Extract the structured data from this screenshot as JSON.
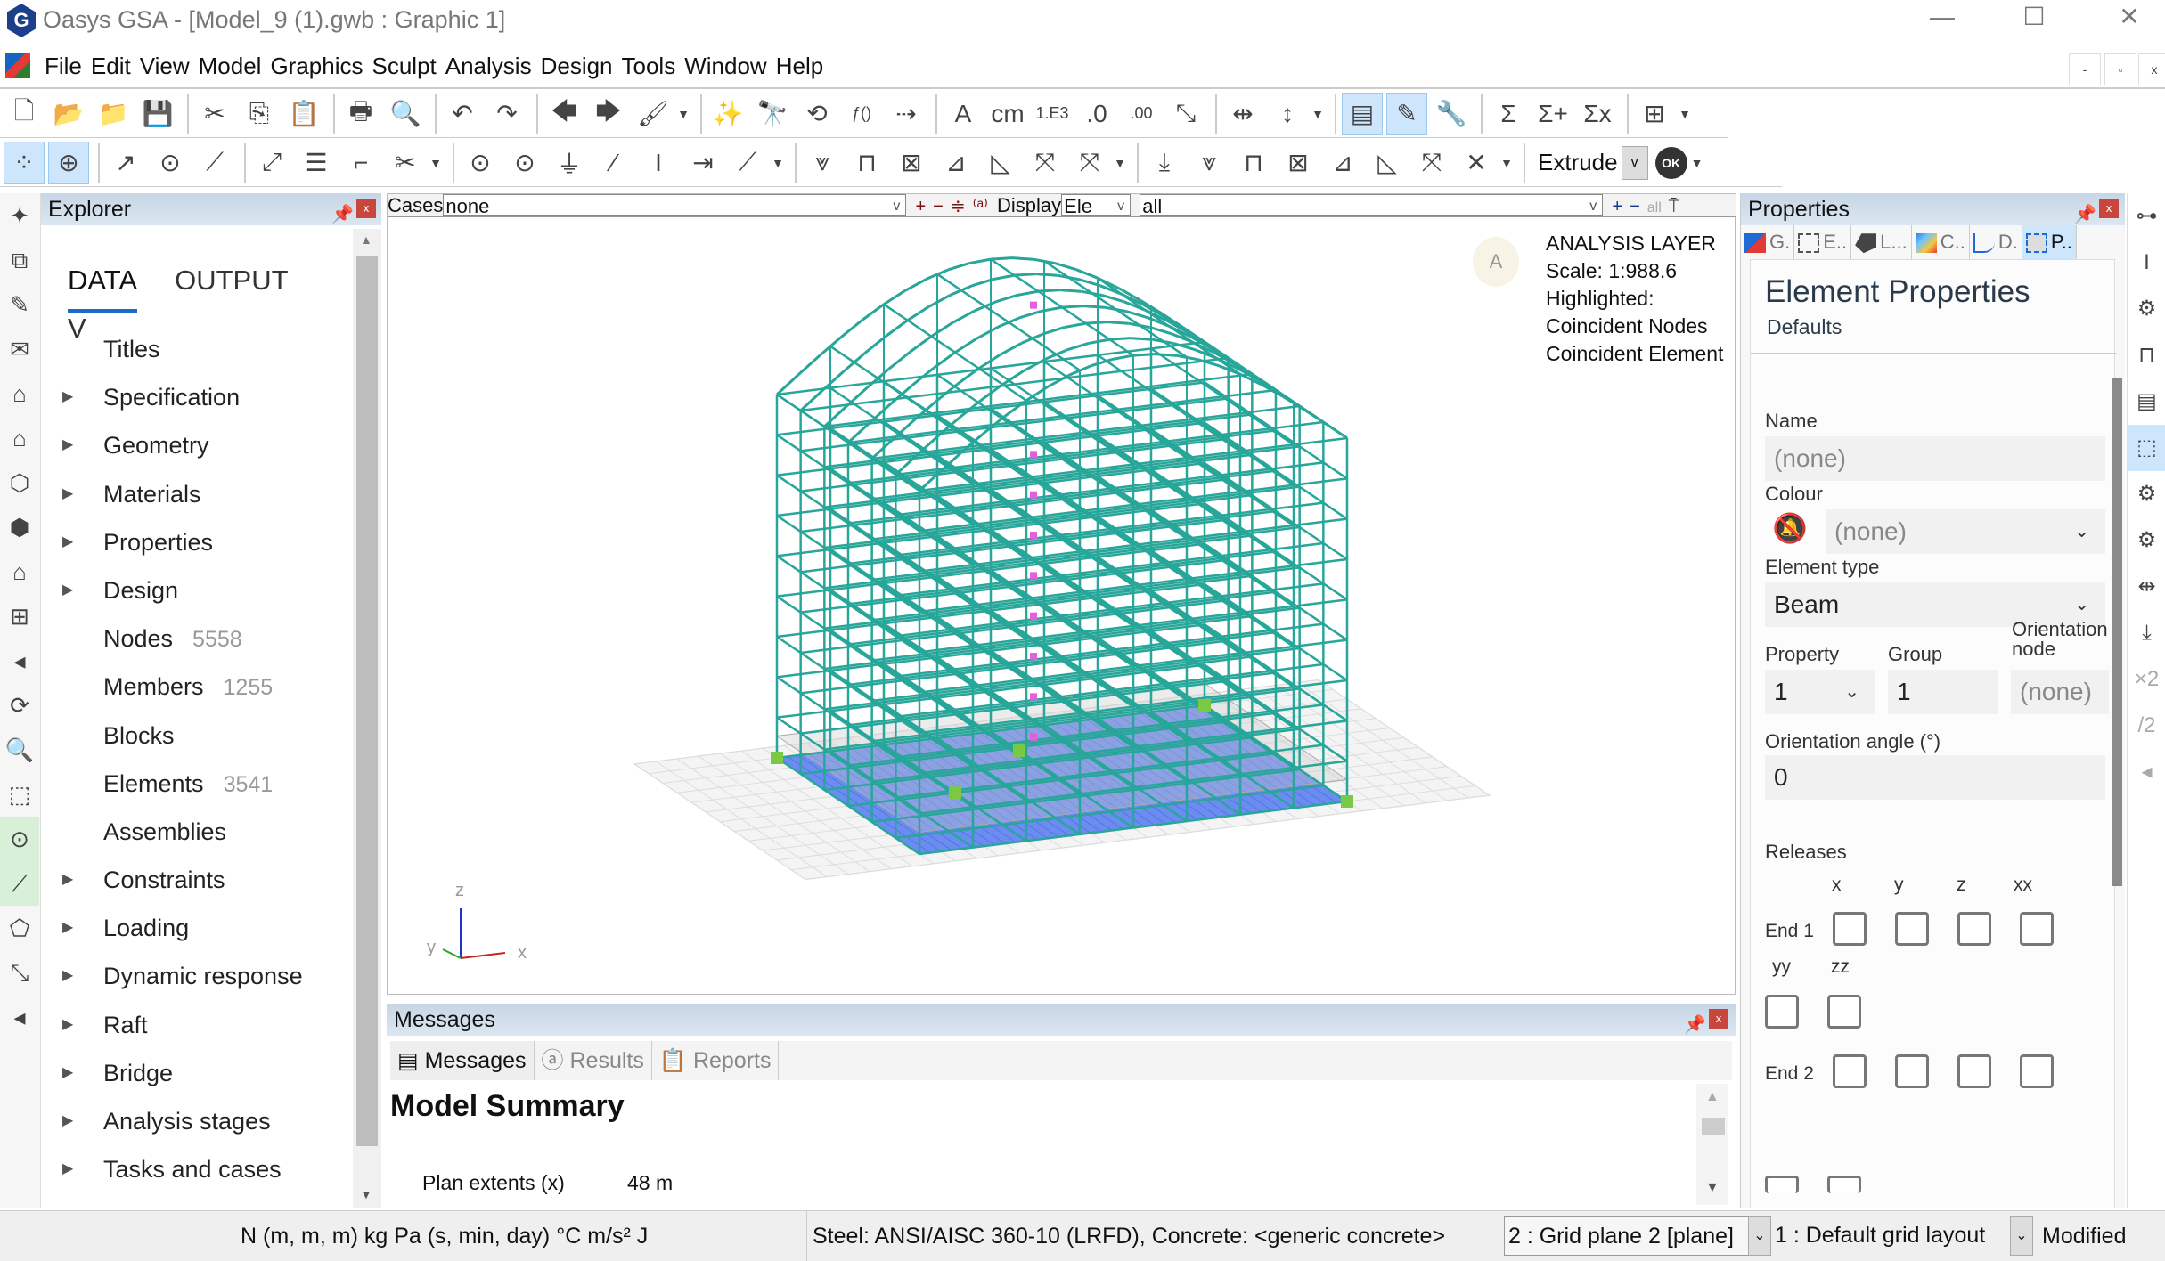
{
  "window": {
    "title": "Oasys GSA - [Model_9 (1).gwb : Graphic 1]",
    "logo": "G",
    "minimize": "—",
    "maximize": "☐",
    "close": "✕"
  },
  "menu": {
    "items": [
      "File",
      "Edit",
      "View",
      "Model",
      "Graphics",
      "Sculpt",
      "Analysis",
      "Design",
      "Tools",
      "Window",
      "Help"
    ],
    "mdi_min": "-",
    "mdi_restore": "▫",
    "mdi_close": "x"
  },
  "toolbar1": [
    {
      "n": "new-file-icon",
      "g": "🗋"
    },
    {
      "n": "open-folder-icon",
      "g": "📂"
    },
    {
      "n": "open-recent-icon",
      "g": "📁"
    },
    {
      "n": "save-icon",
      "g": "💾"
    },
    {
      "sep": true
    },
    {
      "n": "cut-icon",
      "g": "✂"
    },
    {
      "n": "copy-icon",
      "g": "⎘"
    },
    {
      "n": "paste-icon",
      "g": "📋"
    },
    {
      "sep": true
    },
    {
      "n": "print-icon",
      "g": "🖶"
    },
    {
      "n": "print-preview-icon",
      "g": "🔍"
    },
    {
      "sep": true
    },
    {
      "n": "undo-icon",
      "g": "↶"
    },
    {
      "n": "redo-icon",
      "g": "↷"
    },
    {
      "sep": true
    },
    {
      "n": "back-icon",
      "g": "🡄"
    },
    {
      "n": "forward-icon",
      "g": "🡆"
    },
    {
      "n": "clean-brush-icon",
      "g": "🖌"
    },
    {
      "drop": true
    },
    {
      "sep": true
    },
    {
      "n": "wizard-wand-icon",
      "g": "✨"
    },
    {
      "n": "find-binoculars-icon",
      "g": "🔭"
    },
    {
      "n": "sync-icon",
      "g": "⟲"
    },
    {
      "n": "function-icon",
      "g": "ƒ()"
    },
    {
      "n": "insert-icon",
      "g": "⇢"
    },
    {
      "sep": true
    },
    {
      "n": "font-icon",
      "g": "A"
    },
    {
      "n": "units-icon",
      "g": "cm"
    },
    {
      "n": "exponent-format-icon",
      "g": "1.E3"
    },
    {
      "n": "decrease-decimals-icon",
      "g": ".0"
    },
    {
      "n": "increase-decimals-icon",
      "g": ".00"
    },
    {
      "n": "axes-icon",
      "g": "⤡"
    },
    {
      "sep": true
    },
    {
      "n": "column-width-icon",
      "g": "⇹"
    },
    {
      "n": "row-height-icon",
      "g": "↕"
    },
    {
      "drop": true
    },
    {
      "sep": true
    },
    {
      "n": "table-view-icon",
      "g": "▤",
      "on": true
    },
    {
      "n": "edit-pencil-icon",
      "g": "✎",
      "on": true
    },
    {
      "n": "tools-wrench-icon",
      "g": "🔧"
    },
    {
      "sep": true
    },
    {
      "n": "sum-icon",
      "g": "Σ"
    },
    {
      "n": "sum-add-icon",
      "g": "Σ+"
    },
    {
      "n": "sum-delete-icon",
      "g": "Σx"
    },
    {
      "sep": true
    },
    {
      "n": "add-view-icon",
      "g": "⊞"
    },
    {
      "drop": true
    }
  ],
  "toolbar2": [
    {
      "n": "snap-grid-icon",
      "g": "⁘",
      "on": true
    },
    {
      "n": "cursor-target-icon",
      "g": "⊕",
      "on": true
    },
    {
      "sep": true
    },
    {
      "n": "node-path-icon",
      "g": "↗"
    },
    {
      "n": "add-node-icon",
      "g": "⊙"
    },
    {
      "n": "add-element-icon",
      "g": "⟋"
    },
    {
      "sep": true
    },
    {
      "n": "axis-add-icon",
      "g": "⤢"
    },
    {
      "n": "layers-icon",
      "g": "☰"
    },
    {
      "n": "step-icon",
      "g": "⌐"
    },
    {
      "n": "cut-element-icon",
      "g": "✂"
    },
    {
      "drop": true
    },
    {
      "sep": true
    },
    {
      "n": "node-icon",
      "g": "⊙"
    },
    {
      "n": "node-number-icon",
      "g": "⊙"
    },
    {
      "n": "support-icon",
      "g": "⏚"
    },
    {
      "n": "element-number-icon",
      "g": "⁄"
    },
    {
      "n": "section-icon",
      "g": "I"
    },
    {
      "n": "orientation-icon",
      "g": "⇥"
    },
    {
      "n": "local-axis-icon",
      "g": "⟋"
    },
    {
      "drop": true
    },
    {
      "sep": true
    },
    {
      "n": "node-load-color-icon",
      "g": "⩔"
    },
    {
      "n": "beam-load-color-icon",
      "g": "⊓"
    },
    {
      "n": "slab-color-icon",
      "g": "⊠"
    },
    {
      "n": "shear-color-icon",
      "g": "⊿"
    },
    {
      "n": "moment-color-icon",
      "g": "◺"
    },
    {
      "n": "deform-color-icon",
      "g": "⤧"
    },
    {
      "n": "deform-y-color-icon",
      "g": "⤧"
    },
    {
      "drop": true
    },
    {
      "sep": true
    },
    {
      "n": "point-load-icon",
      "g": "⤓"
    },
    {
      "n": "node-displacement-icon",
      "g": "⩔"
    },
    {
      "n": "beam-load-icon",
      "g": "⊓"
    },
    {
      "n": "panel-load-icon",
      "g": "⊠"
    },
    {
      "n": "shear-diagram-icon",
      "g": "⊿"
    },
    {
      "n": "moment-diagram-icon",
      "g": "◺"
    },
    {
      "n": "deformed-shape-icon",
      "g": "⤧"
    },
    {
      "n": "contour-icon",
      "g": "✕"
    },
    {
      "drop": true
    },
    {
      "sep": true
    }
  ],
  "extrude": {
    "label": "Extrude",
    "ok": "OK"
  },
  "left_strip": [
    "model-wizard-icon",
    "label-icon",
    "sketch-pencil-icon",
    "envelope-icon",
    "building-icon",
    "roof-icon",
    "shell-icon",
    "cube-tag-icon",
    "house-icon",
    "grid-expand-icon",
    "collapse-arrow-icon",
    "rotate-icon",
    "zoom-icon",
    "box-view-icon",
    "node-select-icon",
    "element-select-icon",
    "polygon-icon",
    "scale-icon",
    "expand-arrow-icon"
  ],
  "right_strip": [
    "link-nodes-icon",
    "i-beam-icon",
    "settings-tag-icon",
    "frame-icon",
    "clapperboard-icon",
    "cube-import-icon",
    "contour-settings-icon",
    "diagram-settings-icon",
    "shrink-icon",
    "deflection-icon",
    "times-two-icon",
    "divide-two-icon",
    "collapse-arrow-icon"
  ],
  "explorer": {
    "title": "Explorer",
    "tabs": [
      "DATA",
      "OUTPUT",
      "V"
    ],
    "items": [
      {
        "label": "Titles",
        "arrow": false
      },
      {
        "label": "Specification",
        "arrow": true
      },
      {
        "label": "Geometry",
        "arrow": true
      },
      {
        "label": "Materials",
        "arrow": true
      },
      {
        "label": "Properties",
        "arrow": true
      },
      {
        "label": "Design",
        "arrow": true
      },
      {
        "label": "Nodes",
        "arrow": false,
        "count": "5558"
      },
      {
        "label": "Members",
        "arrow": false,
        "count": "1255"
      },
      {
        "label": "Blocks",
        "arrow": false
      },
      {
        "label": "Elements",
        "arrow": false,
        "count": "3541"
      },
      {
        "label": "Assemblies",
        "arrow": false
      },
      {
        "label": "Constraints",
        "arrow": true
      },
      {
        "label": "Loading",
        "arrow": true
      },
      {
        "label": "Dynamic response",
        "arrow": true
      },
      {
        "label": "Raft",
        "arrow": true
      },
      {
        "label": "Bridge",
        "arrow": true
      },
      {
        "label": "Analysis stages",
        "arrow": true
      },
      {
        "label": "Tasks and cases",
        "arrow": true
      }
    ]
  },
  "graphic": {
    "cases_label": "Cases",
    "cases_value": "none",
    "display_label": "Display",
    "display_value": "Ele",
    "filter_value": "all",
    "all_label": "all",
    "layer_badge": "A",
    "legend": [
      "ANALYSIS LAYER",
      "Scale: 1:988.6",
      "Highlighted:",
      "Coincident Nodes",
      "Coincident Element"
    ],
    "axes": {
      "x": "x",
      "y": "y",
      "z": "z"
    },
    "colors": {
      "frame": "#27a699",
      "slab": "#6b8cf0",
      "highlight": "#e060e0",
      "support": "#7ac943"
    }
  },
  "messages": {
    "title": "Messages",
    "tabs": [
      "Messages",
      "Results",
      "Reports"
    ],
    "heading": "Model Summary",
    "rows": [
      {
        "label": "Plan extents (x)",
        "value": "48 m"
      }
    ]
  },
  "properties": {
    "title": "Properties",
    "tabs": [
      "G.",
      "E..",
      "L...",
      "C..",
      "D.",
      "P.."
    ],
    "heading": "Element Properties",
    "subheading": "Defaults",
    "name_label": "Name",
    "name_value": "(none)",
    "colour_label": "Colour",
    "colour_value": "(none)",
    "type_label": "Element type",
    "type_value": "Beam",
    "property_label": "Property",
    "property_value": "1",
    "group_label": "Group",
    "group_value": "1",
    "orient_node_label": "Orientation node",
    "orient_node_value": "(none)",
    "angle_label": "Orientation angle (°)",
    "angle_value": "0",
    "releases_label": "Releases",
    "release_dofs": [
      "x",
      "y",
      "z",
      "xx",
      "yy",
      "zz"
    ],
    "end1": "End 1",
    "end2": "End 2"
  },
  "status": {
    "units": "N  (m, m, m)  kg  Pa  (s, min, day)  °C  m/s²  J",
    "design_codes": "Steel: ANSI/AISC 360-10 (LRFD), Concrete: <generic concrete>",
    "grid_plane": "2 : Grid plane 2 [plane]",
    "grid_layout": "1 : Default grid layout",
    "state": "Modified"
  }
}
